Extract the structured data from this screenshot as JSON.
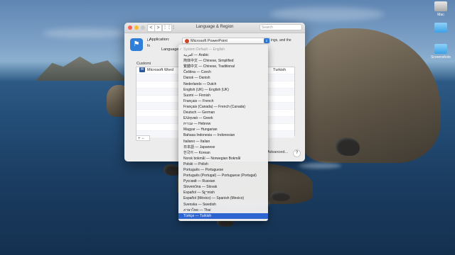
{
  "desktop": {
    "icons": [
      {
        "label": "Mac",
        "icon": "hard-disk-icon"
      },
      {
        "label": "",
        "icon": "folder-icon"
      },
      {
        "label": "Screenshots",
        "icon": "folder-icon"
      }
    ]
  },
  "window": {
    "title": "Language & Region",
    "search_placeholder": "Search",
    "nav_back": "<",
    "nav_forward": ">",
    "grid": "⋮⋮⋮",
    "description_fragment_1": "Li",
    "description_fragment_2": "fo",
    "description_fragment_3": "ings, and the",
    "customize_label": "Customi",
    "table_rows": [
      {
        "app": "Microsoft Word",
        "lang": "Turkish"
      }
    ],
    "add_remove": "+  −",
    "advanced_button": "Advanced...",
    "help_button": "?"
  },
  "application": {
    "label": "Application:",
    "selected": "Microsoft PowerPoint"
  },
  "language_label": "Language",
  "menu": {
    "items": [
      {
        "label": "System Default — English",
        "state": "checked-disabled"
      },
      {
        "label": "العربية — Arabic",
        "state": ""
      },
      {
        "label": "简体中文 — Chinese, Simplified",
        "state": ""
      },
      {
        "label": "繁體中文 — Chinese, Traditional",
        "state": ""
      },
      {
        "label": "Čeština — Czech",
        "state": ""
      },
      {
        "label": "Dansk — Danish",
        "state": ""
      },
      {
        "label": "Nederlands — Dutch",
        "state": ""
      },
      {
        "label": "English (UK) — English (UK)",
        "state": ""
      },
      {
        "label": "Suomi — Finnish",
        "state": ""
      },
      {
        "label": "Français — French",
        "state": ""
      },
      {
        "label": "Français (Canada) — French (Canada)",
        "state": ""
      },
      {
        "label": "Deutsch — German",
        "state": ""
      },
      {
        "label": "Ελληνικά — Greek",
        "state": ""
      },
      {
        "label": "עברית — Hebrew",
        "state": ""
      },
      {
        "label": "Magyar — Hungarian",
        "state": ""
      },
      {
        "label": "Bahasa Indonesia — Indonesian",
        "state": ""
      },
      {
        "label": "Italiano — Italian",
        "state": ""
      },
      {
        "label": "日本語 — Japanese",
        "state": ""
      },
      {
        "label": "한국어 — Korean",
        "state": ""
      },
      {
        "label": "Norsk bokmål — Norwegian Bokmål",
        "state": ""
      },
      {
        "label": "Polski — Polish",
        "state": ""
      },
      {
        "label": "Português — Portuguese",
        "state": ""
      },
      {
        "label": "Português (Portugal) — Portuguese (Portugal)",
        "state": ""
      },
      {
        "label": "Русский — Russian",
        "state": ""
      },
      {
        "label": "Slovenčina — Slovak",
        "state": ""
      },
      {
        "label": "Español — Spanish",
        "state": ""
      },
      {
        "label": "Español (México) — Spanish (Mexico)",
        "state": ""
      },
      {
        "label": "Svenska — Swedish",
        "state": ""
      },
      {
        "label": "ภาษาไทย — Thai",
        "state": ""
      },
      {
        "label": "Türkçe — Turkish",
        "state": "selected"
      }
    ]
  }
}
